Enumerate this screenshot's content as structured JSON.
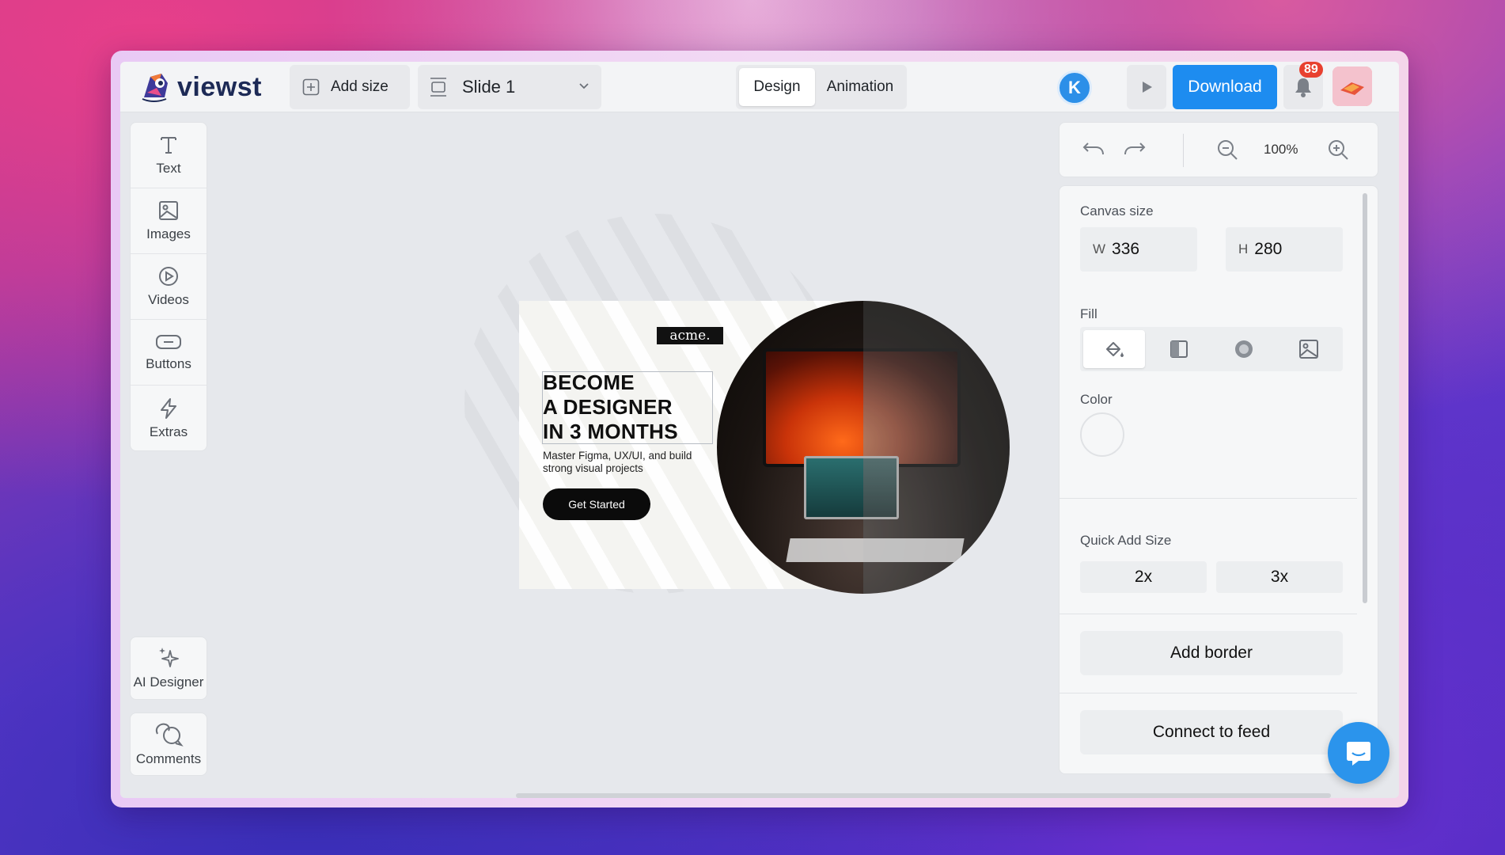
{
  "app": {
    "logo_text": "viewst"
  },
  "topbar": {
    "add_size": "Add size",
    "slide": "Slide 1",
    "tabs": [
      "Design",
      "Animation"
    ],
    "user_initial": "K",
    "download": "Download",
    "notifications": "89"
  },
  "left_tools": [
    {
      "label": "Text",
      "icon": "text-icon"
    },
    {
      "label": "Images",
      "icon": "image-icon"
    },
    {
      "label": "Videos",
      "icon": "play-circle-icon"
    },
    {
      "label": "Buttons",
      "icon": "button-icon"
    },
    {
      "label": "Extras",
      "icon": "lightning-icon"
    }
  ],
  "bottom_tools": {
    "ai": "AI Designer",
    "comments": "Comments"
  },
  "banner": {
    "brand": "acme.",
    "headline_1": "BECOME",
    "headline_2": "A DESIGNER",
    "headline_3": "IN 3 MONTHS",
    "subtitle_1": "Master Figma, UX/UI, and build",
    "subtitle_2": "strong visual projects",
    "cta": "Get Started"
  },
  "zoom": {
    "value": "100%"
  },
  "properties": {
    "canvas_size_label": "Canvas size",
    "width_key": "W",
    "width": "336",
    "height_key": "H",
    "height": "280",
    "fill_label": "Fill",
    "color_label": "Color",
    "quick_add_label": "Quick Add Size",
    "quick_add": [
      "2x",
      "3x"
    ],
    "add_border": "Add border",
    "connect_feed": "Connect to feed"
  },
  "colors": {
    "accent": "#1d8cf0",
    "badge": "#e8402f",
    "avatar": "#2c8fe8"
  }
}
